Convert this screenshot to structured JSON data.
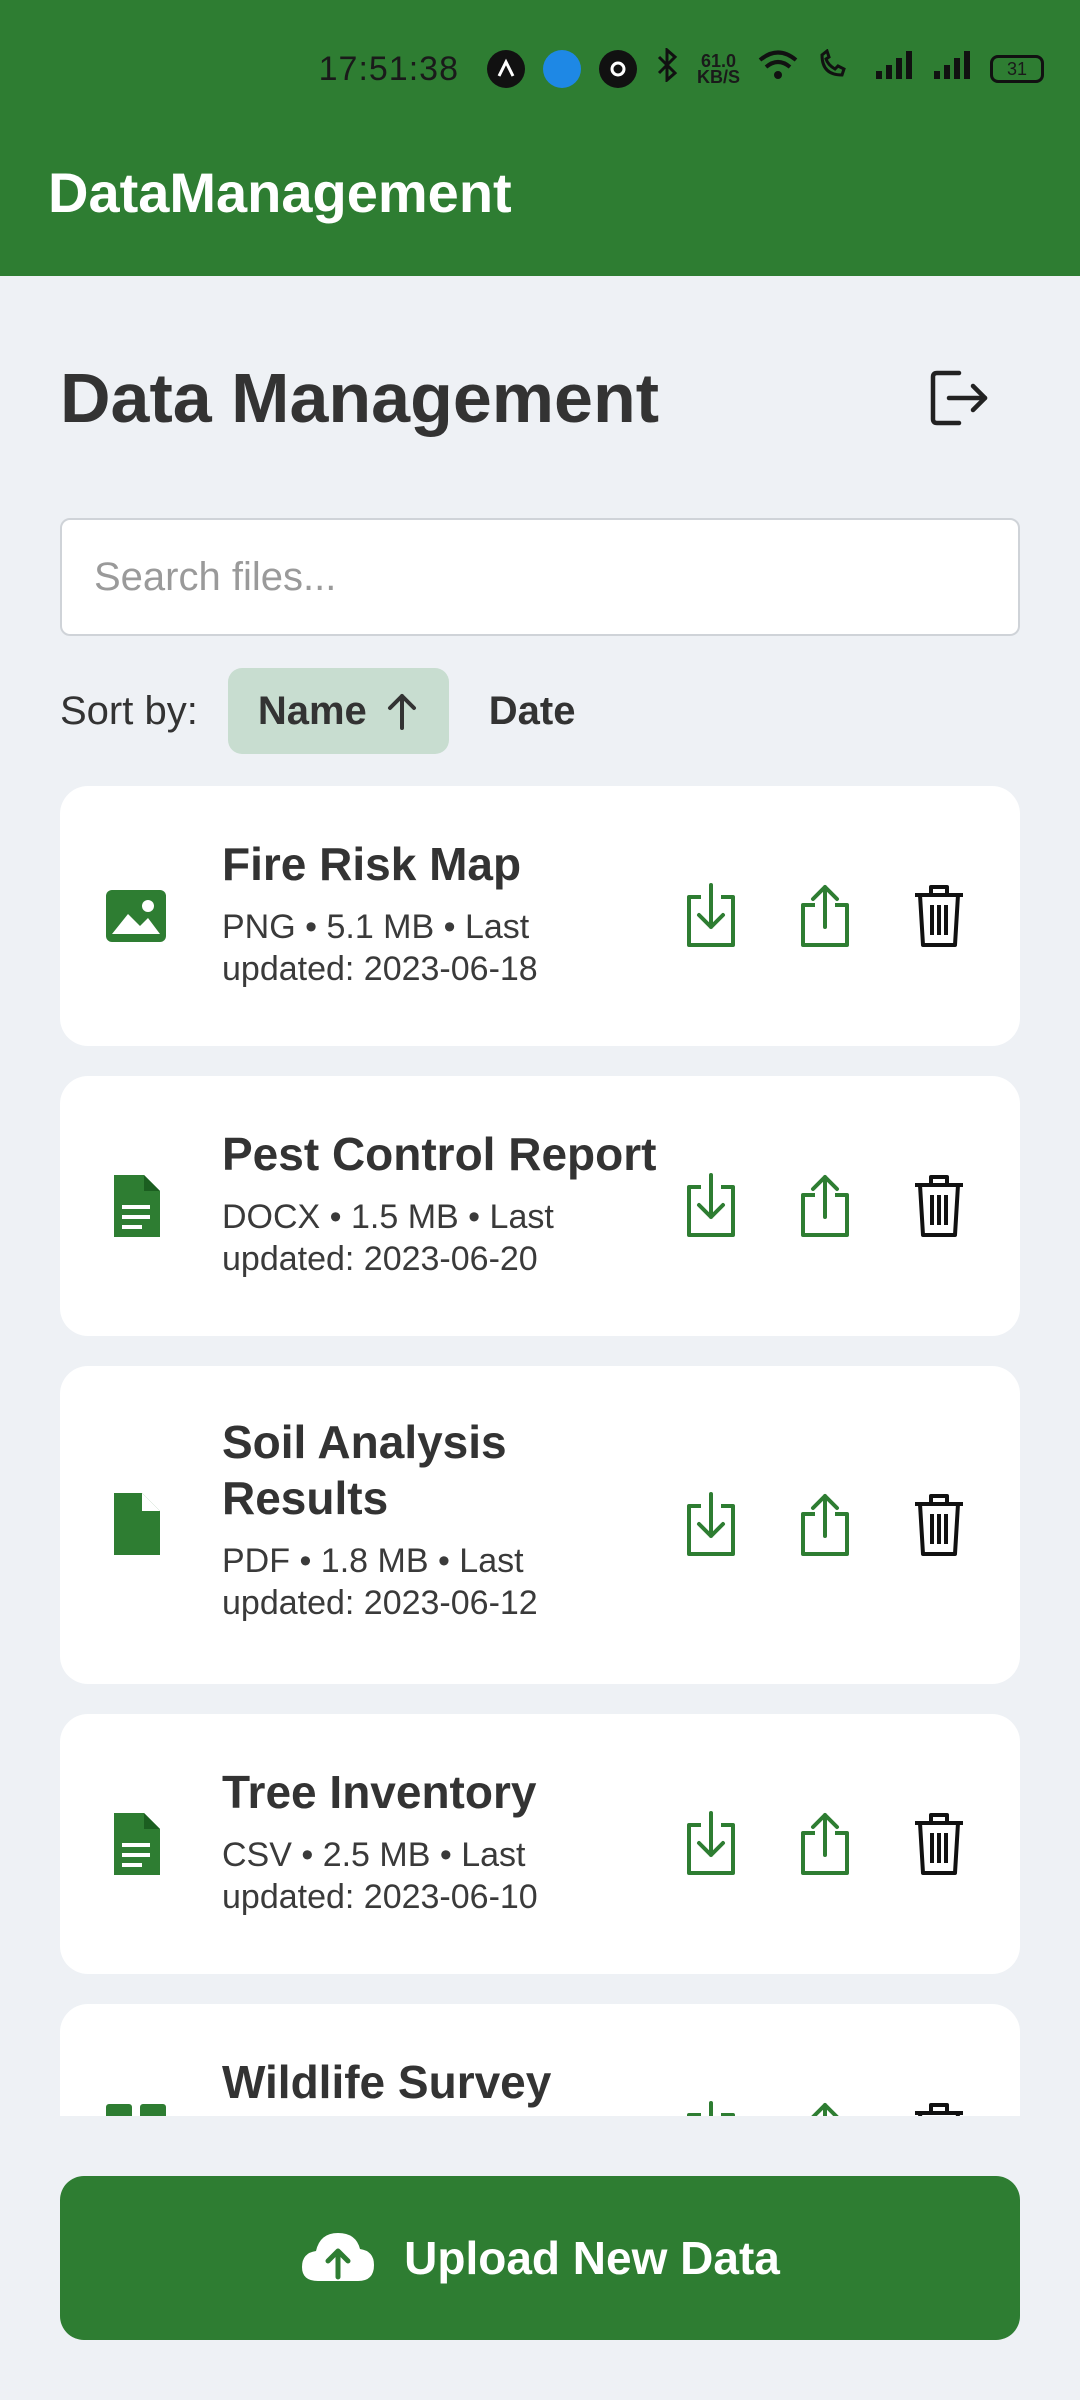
{
  "status_bar": {
    "time": "17:51:38",
    "net_speed_value": "61.0",
    "net_speed_unit": "KB/S",
    "battery": "31"
  },
  "app_bar": {
    "title": "DataManagement"
  },
  "header": {
    "title": "Data Management"
  },
  "search": {
    "placeholder": "Search files..."
  },
  "sort": {
    "label": "Sort by:",
    "name_label": "Name",
    "date_label": "Date"
  },
  "files": [
    {
      "name": "Fire Risk Map",
      "meta": "PNG • 5.1 MB • Last updated: 2023-06-18",
      "icon": "image-file-icon"
    },
    {
      "name": "Pest Control Report",
      "meta": "DOCX • 1.5 MB • Last updated: 2023-06-20",
      "icon": "document-file-icon"
    },
    {
      "name": "Soil Analysis Results",
      "meta": "PDF • 1.8 MB • Last updated: 2023-06-12",
      "icon": "pdf-file-icon"
    },
    {
      "name": "Tree Inventory",
      "meta": "CSV • 2.5 MB • Last updated: 2023-06-10",
      "icon": "document-file-icon"
    },
    {
      "name": "Wildlife Survey",
      "meta": "",
      "icon": "grid-file-icon"
    }
  ],
  "upload_button": {
    "label": "Upload New Data"
  },
  "colors": {
    "primary": "#2e7d32",
    "sort_active_bg": "#c8ddd0",
    "background": "#eef1f5"
  }
}
